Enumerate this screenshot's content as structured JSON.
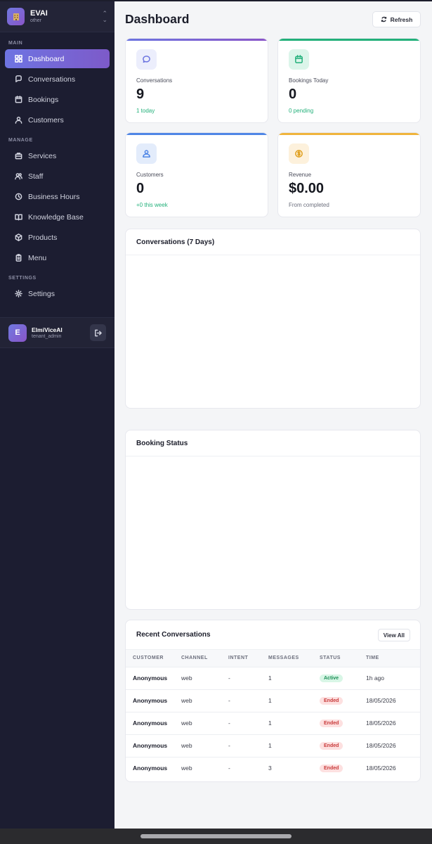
{
  "brand": {
    "name": "EVAI",
    "subtitle": "other"
  },
  "sidebar": {
    "sections": [
      {
        "title": "MAIN",
        "items": [
          {
            "label": "Dashboard",
            "icon": "dashboard-icon",
            "active": true
          },
          {
            "label": "Conversations",
            "icon": "chat-icon"
          },
          {
            "label": "Bookings",
            "icon": "calendar-icon"
          },
          {
            "label": "Customers",
            "icon": "user-icon"
          }
        ]
      },
      {
        "title": "MANAGE",
        "items": [
          {
            "label": "Services",
            "icon": "briefcase-icon"
          },
          {
            "label": "Staff",
            "icon": "users-icon"
          },
          {
            "label": "Business Hours",
            "icon": "clock-icon"
          },
          {
            "label": "Knowledge Base",
            "icon": "book-icon"
          },
          {
            "label": "Products",
            "icon": "box-icon"
          },
          {
            "label": "Menu",
            "icon": "clipboard-icon"
          }
        ]
      },
      {
        "title": "SETTINGS",
        "items": [
          {
            "label": "Settings",
            "icon": "gear-icon"
          }
        ]
      }
    ]
  },
  "user": {
    "initial": "E",
    "name": "ElmiViceAI",
    "role": "tenant_admin"
  },
  "header": {
    "title": "Dashboard",
    "refresh_label": "Refresh"
  },
  "stats": [
    {
      "label": "Conversations",
      "value": "9",
      "sub": "1 today",
      "accent": "#7065d8",
      "icon": "chat-icon"
    },
    {
      "label": "Bookings Today",
      "value": "0",
      "sub": "0 pending",
      "accent": "#22b07a",
      "icon": "calendar-icon"
    },
    {
      "label": "Customers",
      "value": "0",
      "sub": "+0 this week",
      "accent": "#4f86e6",
      "icon": "user-icon"
    },
    {
      "label": "Revenue",
      "value": "$0.00",
      "sub": "From completed",
      "accent": "#f0b43c",
      "icon": "dollar-icon"
    }
  ],
  "charts": {
    "conversations_title": "Conversations (7 Days)",
    "booking_status_title": "Booking Status"
  },
  "recent": {
    "title": "Recent Conversations",
    "view_all": "View All",
    "columns": [
      "CUSTOMER",
      "CHANNEL",
      "INTENT",
      "MESSAGES",
      "STATUS",
      "TIME"
    ],
    "rows": [
      {
        "customer": "Anonymous",
        "channel": "web",
        "intent": "-",
        "messages": "1",
        "status": "Active",
        "time": "1h ago"
      },
      {
        "customer": "Anonymous",
        "channel": "web",
        "intent": "-",
        "messages": "1",
        "status": "Ended",
        "time": "18/05/2026"
      },
      {
        "customer": "Anonymous",
        "channel": "web",
        "intent": "-",
        "messages": "1",
        "status": "Ended",
        "time": "18/05/2026"
      },
      {
        "customer": "Anonymous",
        "channel": "web",
        "intent": "-",
        "messages": "1",
        "status": "Ended",
        "time": "18/05/2026"
      },
      {
        "customer": "Anonymous",
        "channel": "web",
        "intent": "-",
        "messages": "3",
        "status": "Ended",
        "time": "18/05/2026"
      }
    ]
  }
}
